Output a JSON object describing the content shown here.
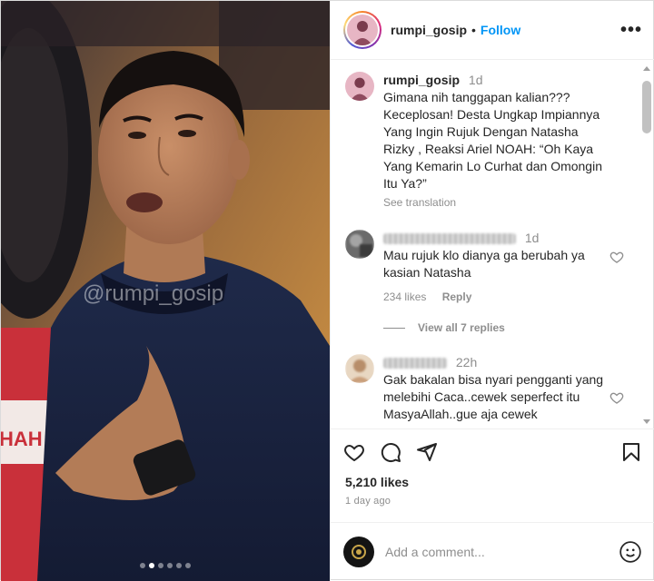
{
  "post": {
    "username": "rumpi_gosip",
    "follow_label": "Follow",
    "more_label": "•••",
    "watermark": "@rumpi_gosip",
    "media_partial_text": "HAH",
    "carousel": {
      "count": 6,
      "active_index": 1
    }
  },
  "caption": {
    "username": "rumpi_gosip",
    "time": "1d",
    "text": "Gimana nih tanggapan kalian??? Keceplosan! Desta Ungkap Impiannya Yang Ingin Rujuk Dengan Natasha Rizky , Reaksi Ariel NOAH: “Oh Kaya Yang Kemarin Lo Curhat dan Omongin Itu Ya?”",
    "see_translation": "See translation"
  },
  "comments": [
    {
      "time": "1d",
      "text": "Mau rujuk klo dianya ga berubah ya kasian Natasha",
      "likes": "234 likes",
      "reply_label": "Reply",
      "view_replies": "View all 7 replies"
    },
    {
      "time": "22h",
      "text": "Gak bakalan bisa nyari pengganti yang melebihi Caca..cewek seperfect itu MasyaAllah..gue aja cewek"
    }
  ],
  "footer": {
    "likes": "5,210 likes",
    "date": "1 day ago",
    "add_comment_placeholder": "Add a comment..."
  },
  "icons": {
    "like": "heart-icon",
    "comment": "comment-icon",
    "share": "paper-plane-icon",
    "save": "bookmark-icon",
    "emoji": "smiley-icon",
    "more": "ellipsis-icon"
  },
  "colors": {
    "accent": "#0095f6",
    "text": "#262626",
    "muted": "#8e8e8e"
  }
}
